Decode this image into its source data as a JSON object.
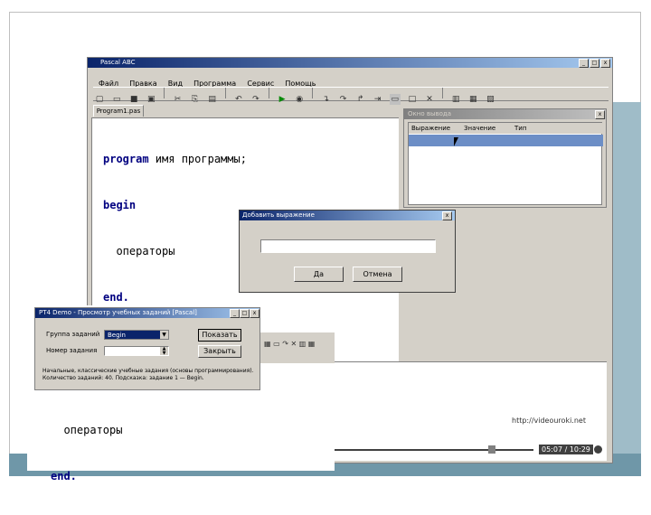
{
  "ide": {
    "title": "Pascal ABC",
    "menu": [
      "Файл",
      "Правка",
      "Вид",
      "Программа",
      "Сервис",
      "Помощь"
    ],
    "tab": "Program1.pas",
    "code": {
      "line1_kw": "program",
      "line1_rest": " имя программы;",
      "line2": "begin",
      "line3": "  операторы",
      "line4": "end."
    }
  },
  "watch": {
    "title": "Окно вывода",
    "col_expr": "Выражение",
    "col_value": "Значение",
    "col_type": "Тип"
  },
  "add_dialog": {
    "title": "Добавить выражение",
    "input_value": "",
    "ok": "Да",
    "cancel": "Отмена"
  },
  "pt": {
    "title": "PT4 Demo - Просмотр учебных заданий [Pascal]",
    "label_group": "Группа заданий",
    "group_value": "Begin",
    "label_number": "Номер задания",
    "number_value": "",
    "btn_show": "Показать",
    "btn_close": "Закрыть",
    "info": "Начальные, классические учебные задания (основы программирования).\nКоличество заданий: 40. Подсказка: задание 1 — Begin."
  },
  "lower": {
    "code_line": "  операторы",
    "code_end": "end.",
    "watermark": "http://videouroki.net",
    "time": "05:07 / 10:29"
  }
}
